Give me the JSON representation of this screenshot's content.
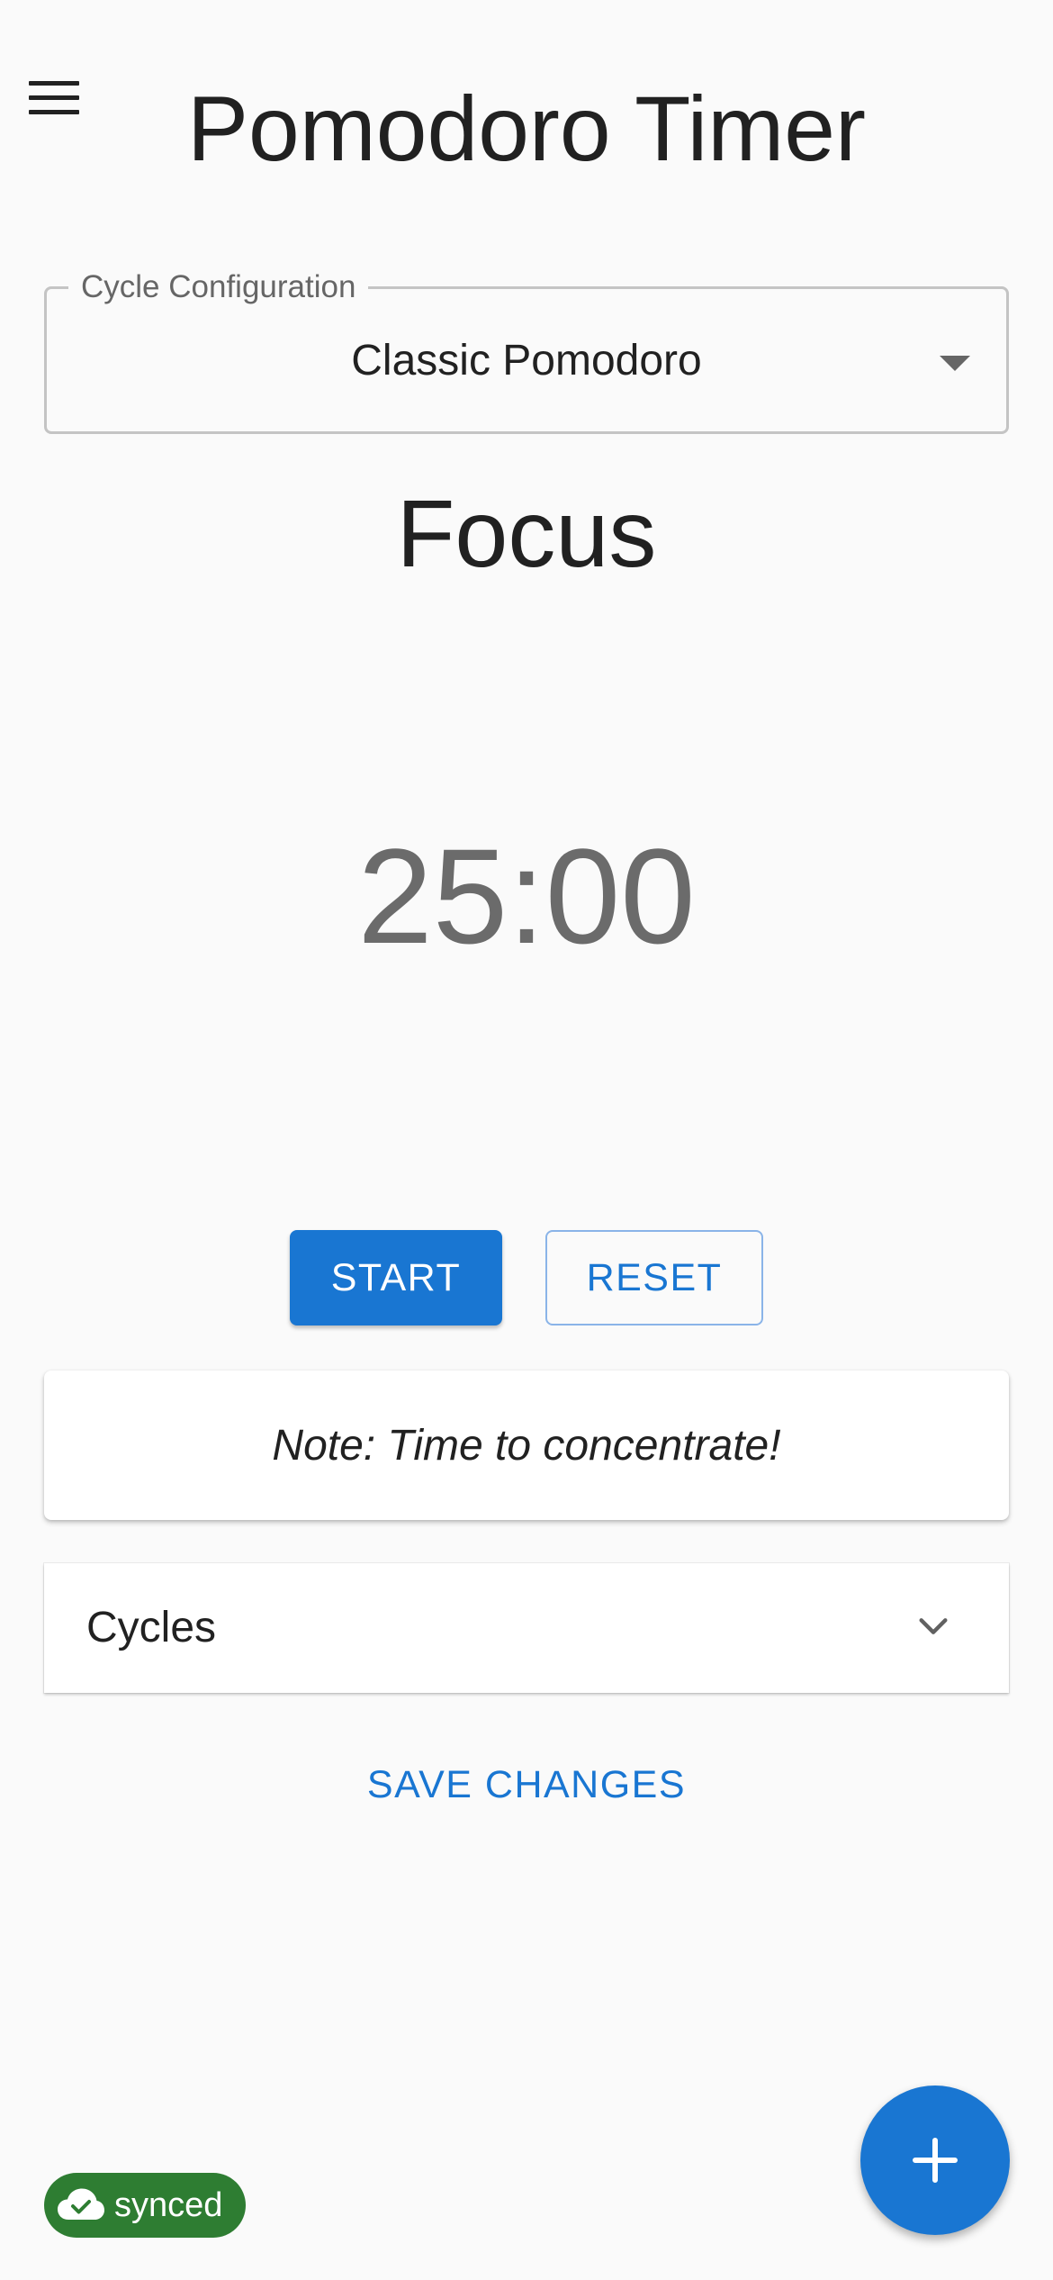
{
  "header": {
    "title": "Pomodoro Timer",
    "menu_icon": "menu-icon"
  },
  "cycle_config": {
    "label": "Cycle Configuration",
    "selected": "Classic Pomodoro",
    "icon": "dropdown-arrow-icon"
  },
  "timer": {
    "phase": "Focus",
    "display": "25:00"
  },
  "controls": {
    "start_label": "START",
    "reset_label": "RESET"
  },
  "note": {
    "text": "Note: Time to concentrate!"
  },
  "cycles_panel": {
    "title": "Cycles",
    "expanded": false,
    "icon": "chevron-down-icon"
  },
  "actions": {
    "save_label": "SAVE CHANGES"
  },
  "status": {
    "sync_label": "synced",
    "icon": "cloud-check-icon"
  },
  "fab": {
    "icon": "plus-icon"
  },
  "colors": {
    "primary": "#1976d2",
    "success": "#2e7d32",
    "background": "#fafafa",
    "timer_text": "#6b6b6b"
  }
}
